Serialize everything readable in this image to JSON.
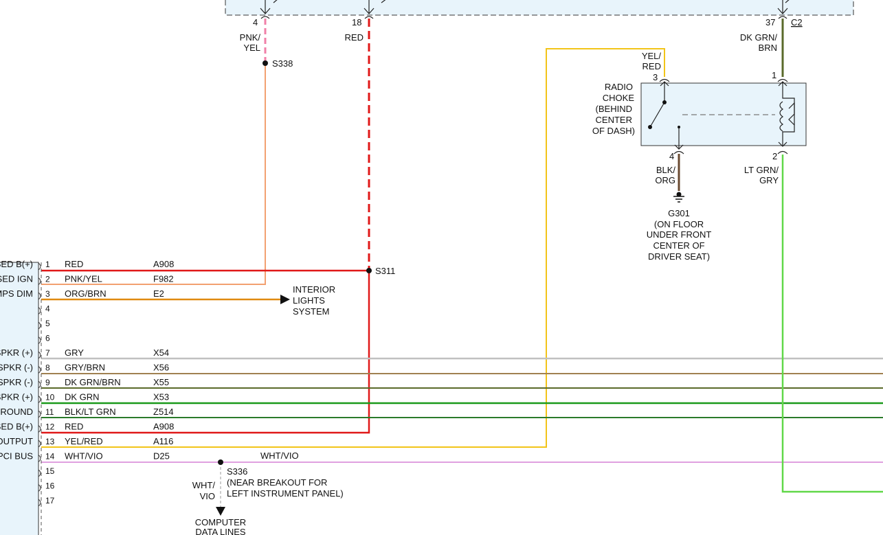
{
  "colors": {
    "red": "#e01818",
    "pink": "#f080a8",
    "pink_yel": "#f2a070",
    "orange": "#e08a10",
    "yellow": "#f2c418",
    "gray": "#c0c0c0",
    "brown": "#a08050",
    "dk_green": "#2a7a2a",
    "bright_green": "#1a9a1a",
    "lt_green": "#60d848",
    "violet": "#e0a0e0",
    "dk_grn_brn": "#5a6a2a",
    "blk_org": "#6a4a30",
    "box_fill": "#e8f4fb"
  },
  "top_connector": {
    "pin4": {
      "num": "4",
      "color_l1": "PNK/",
      "color_l2": "YEL"
    },
    "pin18": {
      "num": "18",
      "color": "RED"
    },
    "pin37": {
      "num": "37",
      "connector": "C2",
      "color_l1": "DK GRN/",
      "color_l2": "BRN"
    }
  },
  "splices": {
    "s338": "S338",
    "s311": "S311",
    "s336_l1": "S336",
    "s336_l2": "(NEAR BREAKOUT FOR",
    "s336_l3": "LEFT INSTRUMENT PANEL)"
  },
  "radio_choke": {
    "label": [
      "RADIO",
      "CHOKE",
      "(BEHIND",
      "CENTER",
      "OF DASH)"
    ],
    "pin3": {
      "num": "3",
      "color_l1": "YEL/",
      "color_l2": "RED"
    },
    "pin1": {
      "num": "1"
    },
    "pin4": {
      "num": "4",
      "color_l1": "BLK/",
      "color_l2": "ORG"
    },
    "pin2": {
      "num": "2",
      "color_l1": "LT GRN/",
      "color_l2": "GRY"
    }
  },
  "ground": {
    "id": "G301",
    "desc": [
      "(ON FLOOR",
      "UNDER FRONT",
      "CENTER OF",
      "DRIVER SEAT)"
    ]
  },
  "interior_lights": [
    "INTERIOR",
    "LIGHTS",
    "SYSTEM"
  ],
  "computer_lines": {
    "wire_l1": "WHT/",
    "wire_l2": "VIO",
    "dest_l1": "COMPUTER",
    "dest_l2": "DATA LINES"
  },
  "wht_vio_label": "WHT/VIO",
  "radio_pins": [
    {
      "pin": "1",
      "func": "SED B(+)",
      "color": "RED",
      "circuit": "A908"
    },
    {
      "pin": "2",
      "func": "SED IGN",
      "color": "PNK/YEL",
      "circuit": "F982"
    },
    {
      "pin": "3",
      "func": "MPS DIM",
      "color": "ORG/BRN",
      "circuit": "E2"
    },
    {
      "pin": "4",
      "func": "",
      "color": "",
      "circuit": ""
    },
    {
      "pin": "5",
      "func": "",
      "color": "",
      "circuit": ""
    },
    {
      "pin": "6",
      "func": "",
      "color": "",
      "circuit": ""
    },
    {
      "pin": "7",
      "func": "SPKR (+)",
      "color": "GRY",
      "circuit": "X54"
    },
    {
      "pin": "8",
      "func": "SPKR (-)",
      "color": "GRY/BRN",
      "circuit": "X56"
    },
    {
      "pin": "9",
      "func": "SPKR (-)",
      "color": "DK GRN/BRN",
      "circuit": "X55"
    },
    {
      "pin": "10",
      "func": "SPKR (+)",
      "color": "DK GRN",
      "circuit": "X53"
    },
    {
      "pin": "11",
      "func": "ROUND",
      "color": "BLK/LT GRN",
      "circuit": "Z514"
    },
    {
      "pin": "12",
      "func": "SED B(+)",
      "color": "RED",
      "circuit": "A908"
    },
    {
      "pin": "13",
      "func": "OUTPUT",
      "color": "YEL/RED",
      "circuit": "A116"
    },
    {
      "pin": "14",
      "func": "PCI BUS",
      "color": "WHT/VIO",
      "circuit": "D25"
    },
    {
      "pin": "15",
      "func": "",
      "color": "",
      "circuit": ""
    },
    {
      "pin": "16",
      "func": "",
      "color": "",
      "circuit": ""
    },
    {
      "pin": "17",
      "func": "",
      "color": "",
      "circuit": ""
    }
  ]
}
